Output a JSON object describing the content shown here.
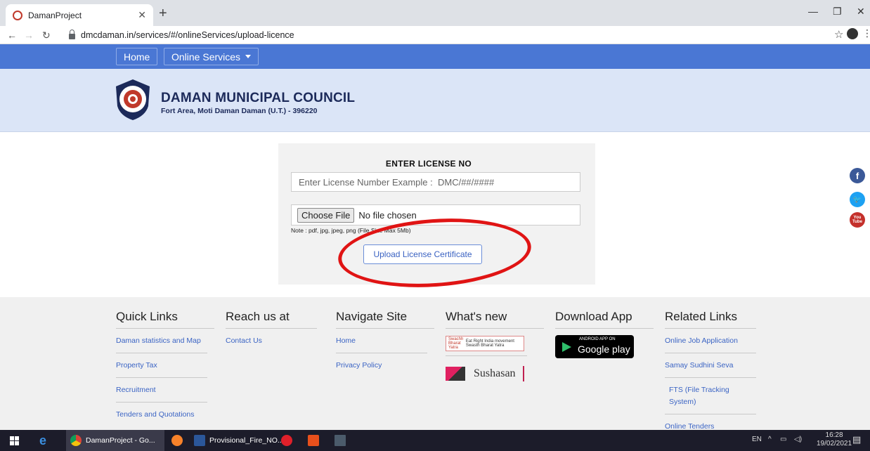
{
  "browser": {
    "tab_title": "DamanProject",
    "url": "dmcdaman.in/services/#/onlineServices/upload-licence"
  },
  "nav": {
    "home": "Home",
    "online_services": "Online Services"
  },
  "header": {
    "org_name": "DAMAN MUNICIPAL COUNCIL",
    "address": "Fort Area, Moti Daman Daman (U.T.) - 396220"
  },
  "upload": {
    "title": "ENTER LICENSE NO",
    "license_placeholder": "Enter License Number Example :  DMC/##/####",
    "choose_file": "Choose File",
    "no_file": "No file chosen",
    "note": "Note : pdf, jpg, jpeg, png (File Size Max 5Mb)",
    "upload_button": "Upload License Certificate"
  },
  "social": {
    "facebook": "f",
    "twitter": "t",
    "youtube": "You Tube"
  },
  "footer": {
    "quick_links": {
      "heading": "Quick Links",
      "items": [
        "Daman statistics and Map",
        "Property Tax",
        "Recruitment",
        "Tenders and Quotations"
      ]
    },
    "reach_us": {
      "heading": "Reach us at",
      "items": [
        "Contact Us"
      ]
    },
    "navigate": {
      "heading": "Navigate Site",
      "items": [
        "Home",
        "Privacy Policy"
      ]
    },
    "whats_new": {
      "heading": "What's new",
      "swachh_left": "Swachh Bharat Yatra",
      "swachh_right": "Eat Right India movement Swasth Bharat Yatra",
      "sushasan": "Sushasan"
    },
    "download_app": {
      "heading": "Download App",
      "badge_small": "ANDROID APP ON",
      "badge_big": "Google play"
    },
    "related": {
      "heading": "Related Links",
      "items": [
        "Online Job Application",
        "Samay Sudhini Seva",
        "FTS (File Tracking System)",
        "Online Tenders"
      ]
    }
  },
  "taskbar": {
    "chrome_item": "DamanProject - Go...",
    "word_item": "Provisional_Fire_NO...",
    "lang": "EN",
    "time": "16:28",
    "date": "19/02/2021"
  }
}
